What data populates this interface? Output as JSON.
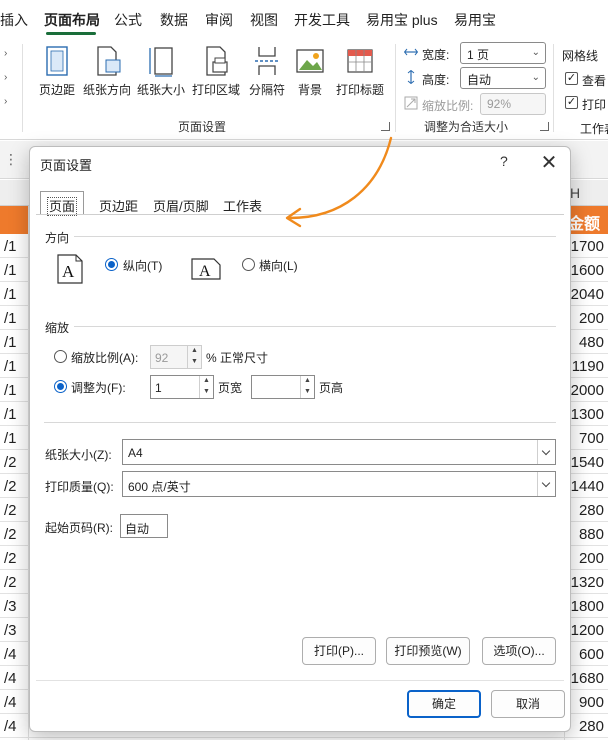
{
  "ribbon_tabs": [
    "插入",
    "页面布局",
    "公式",
    "数据",
    "审阅",
    "视图",
    "开发工具",
    "易用宝 plus",
    "易用宝"
  ],
  "ribbon_active_tab": "页面布局",
  "page_setup_group": {
    "buttons": [
      "页边距",
      "纸张方向",
      "纸张大小",
      "打印区域",
      "分隔符",
      "背景",
      "打印标题"
    ],
    "label": "页面设置"
  },
  "fit_group": {
    "width_label": "宽度:",
    "width_value": "1 页",
    "height_label": "高度:",
    "height_value": "自动",
    "scale_label": "缩放比例:",
    "scale_value": "92%",
    "label": "调整为合适大小"
  },
  "sheet_options": {
    "gridlines_label": "网格线",
    "view_label": "查看",
    "print_label": "打印",
    "cut_label": "工作表"
  },
  "sheet": {
    "header_right": "金额",
    "col_letter": "H",
    "rows": [
      {
        "left": "/1",
        "right": "1700"
      },
      {
        "left": "/1",
        "right": "1600"
      },
      {
        "left": "/1",
        "right": "2040"
      },
      {
        "left": "/1",
        "right": "200"
      },
      {
        "left": "/1",
        "right": "480"
      },
      {
        "left": "/1",
        "right": "1190"
      },
      {
        "left": "/1",
        "right": "2000"
      },
      {
        "left": "/1",
        "right": "1300"
      },
      {
        "left": "/1",
        "right": "700"
      },
      {
        "left": "/2",
        "right": "1540"
      },
      {
        "left": "/2",
        "right": "1440"
      },
      {
        "left": "/2",
        "right": "280"
      },
      {
        "left": "/2",
        "right": "880"
      },
      {
        "left": "/2",
        "right": "200"
      },
      {
        "left": "/2",
        "right": "1320"
      },
      {
        "left": "/3",
        "right": "1800"
      },
      {
        "left": "/3",
        "right": "1200"
      },
      {
        "left": "/4",
        "right": "600"
      },
      {
        "left": "/4",
        "right": "1680"
      },
      {
        "left": "/4",
        "right": "900"
      },
      {
        "left": "/4",
        "right": "280"
      }
    ]
  },
  "dialog": {
    "title": "页面设置",
    "help": "?",
    "close": "✕",
    "tabs": [
      "页面",
      "页边距",
      "页眉/页脚",
      "工作表"
    ],
    "orientation": {
      "section": "方向",
      "portrait_label": "纵向(T)",
      "landscape_label": "横向(L)",
      "icon_glyph": "A"
    },
    "scaling": {
      "section": "缩放",
      "adjust_label": "缩放比例(A):",
      "adjust_value": "92",
      "percent_label": "% 正常尺寸",
      "fit_label": "调整为(F):",
      "fit_wide_value": "1",
      "fit_wide_label": "页宽",
      "fit_tall_value": "",
      "fit_tall_label": "页高"
    },
    "paper_size": {
      "label": "纸张大小(Z):",
      "value": "A4"
    },
    "print_quality": {
      "label": "打印质量(Q):",
      "value": "600 点/英寸"
    },
    "first_page": {
      "label": "起始页码(R):",
      "value": "自动"
    },
    "buttons": {
      "print": "打印(P)...",
      "preview": "打印预览(W)",
      "options": "选项(O)...",
      "ok": "确定",
      "cancel": "取消"
    }
  },
  "colors": {
    "accent": "#ee7a2c",
    "radio": "#0a62c9",
    "arrow": "#f08a1c"
  }
}
